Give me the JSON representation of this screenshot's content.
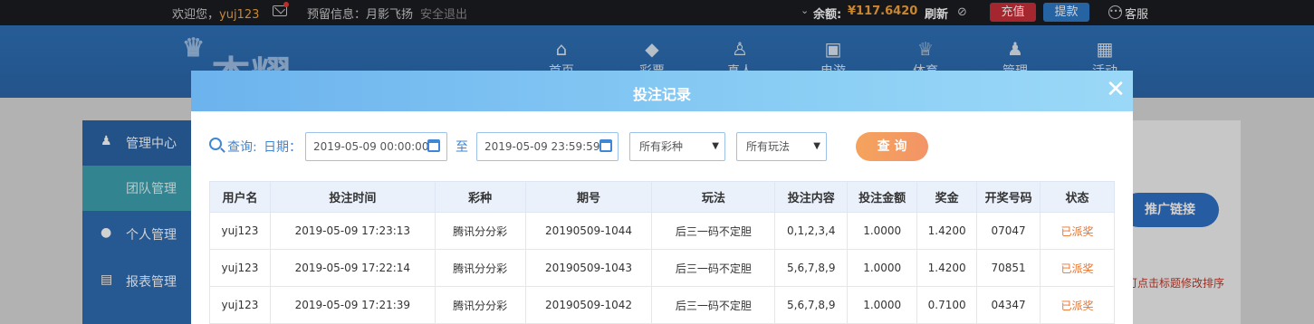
{
  "topbar": {
    "welcome": "欢迎您，",
    "username": "yuj123",
    "reserve_info": "预留信息：月影飞扬",
    "logout": "安全退出",
    "balance_label": "余额:",
    "balance_value": "¥117.6420",
    "refresh": "刷新",
    "recharge": "充值",
    "withdraw": "提款",
    "service": "客服"
  },
  "header": {
    "logo_text": "杰耀",
    "nav": [
      {
        "label": "首页",
        "icon": "home-icon"
      },
      {
        "label": "彩票",
        "icon": "ticket-icon"
      },
      {
        "label": "真人",
        "icon": "live-dealer-icon"
      },
      {
        "label": "电游",
        "icon": "slot-machine-icon"
      },
      {
        "label": "体育",
        "icon": "trophy-icon"
      },
      {
        "label": "管理",
        "icon": "users-icon"
      },
      {
        "label": "活动",
        "icon": "gift-icon"
      }
    ]
  },
  "sidebar": {
    "items": [
      {
        "label": "管理中心",
        "icon": "users-icon"
      },
      {
        "label": "团队管理"
      },
      {
        "label": "个人管理",
        "icon": "user-icon"
      },
      {
        "label": "报表管理",
        "icon": "report-icon"
      }
    ]
  },
  "main": {
    "promo_button": "推广链接",
    "hint": "可点击标题修改排序"
  },
  "modal": {
    "title": "投注记录",
    "filter": {
      "query_label": "查询:",
      "date_label": "日期：",
      "date_from": "2019-05-09 00:00:00",
      "to_label": "至",
      "date_to": "2019-05-09 23:59:59",
      "lottery_select": "所有彩种",
      "play_select": "所有玩法",
      "query_button": "查 询"
    },
    "table": {
      "headers": [
        "用户名",
        "投注时间",
        "彩种",
        "期号",
        "玩法",
        "投注内容",
        "投注金额",
        "奖金",
        "开奖号码",
        "状态"
      ],
      "rows": [
        [
          "yuj123",
          "2019-05-09 17:23:13",
          "腾讯分分彩",
          "20190509-1044",
          "后三一码不定胆",
          "0,1,2,3,4",
          "1.0000",
          "1.4200",
          "07047",
          "已派奖"
        ],
        [
          "yuj123",
          "2019-05-09 17:22:14",
          "腾讯分分彩",
          "20190509-1043",
          "后三一码不定胆",
          "5,6,7,8,9",
          "1.0000",
          "1.4200",
          "70851",
          "已派奖"
        ],
        [
          "yuj123",
          "2019-05-09 17:21:39",
          "腾讯分分彩",
          "20190509-1042",
          "后三一码不定胆",
          "5,6,7,8,9",
          "1.0000",
          "0.7100",
          "04347",
          "已派奖"
        ]
      ]
    }
  },
  "colors": {
    "accent_blue": "#3f86d6",
    "status_orange": "#e8722c",
    "balance_orange": "#f4a43b",
    "recharge_red": "#c9303a",
    "withdraw_blue": "#2f79c6"
  }
}
